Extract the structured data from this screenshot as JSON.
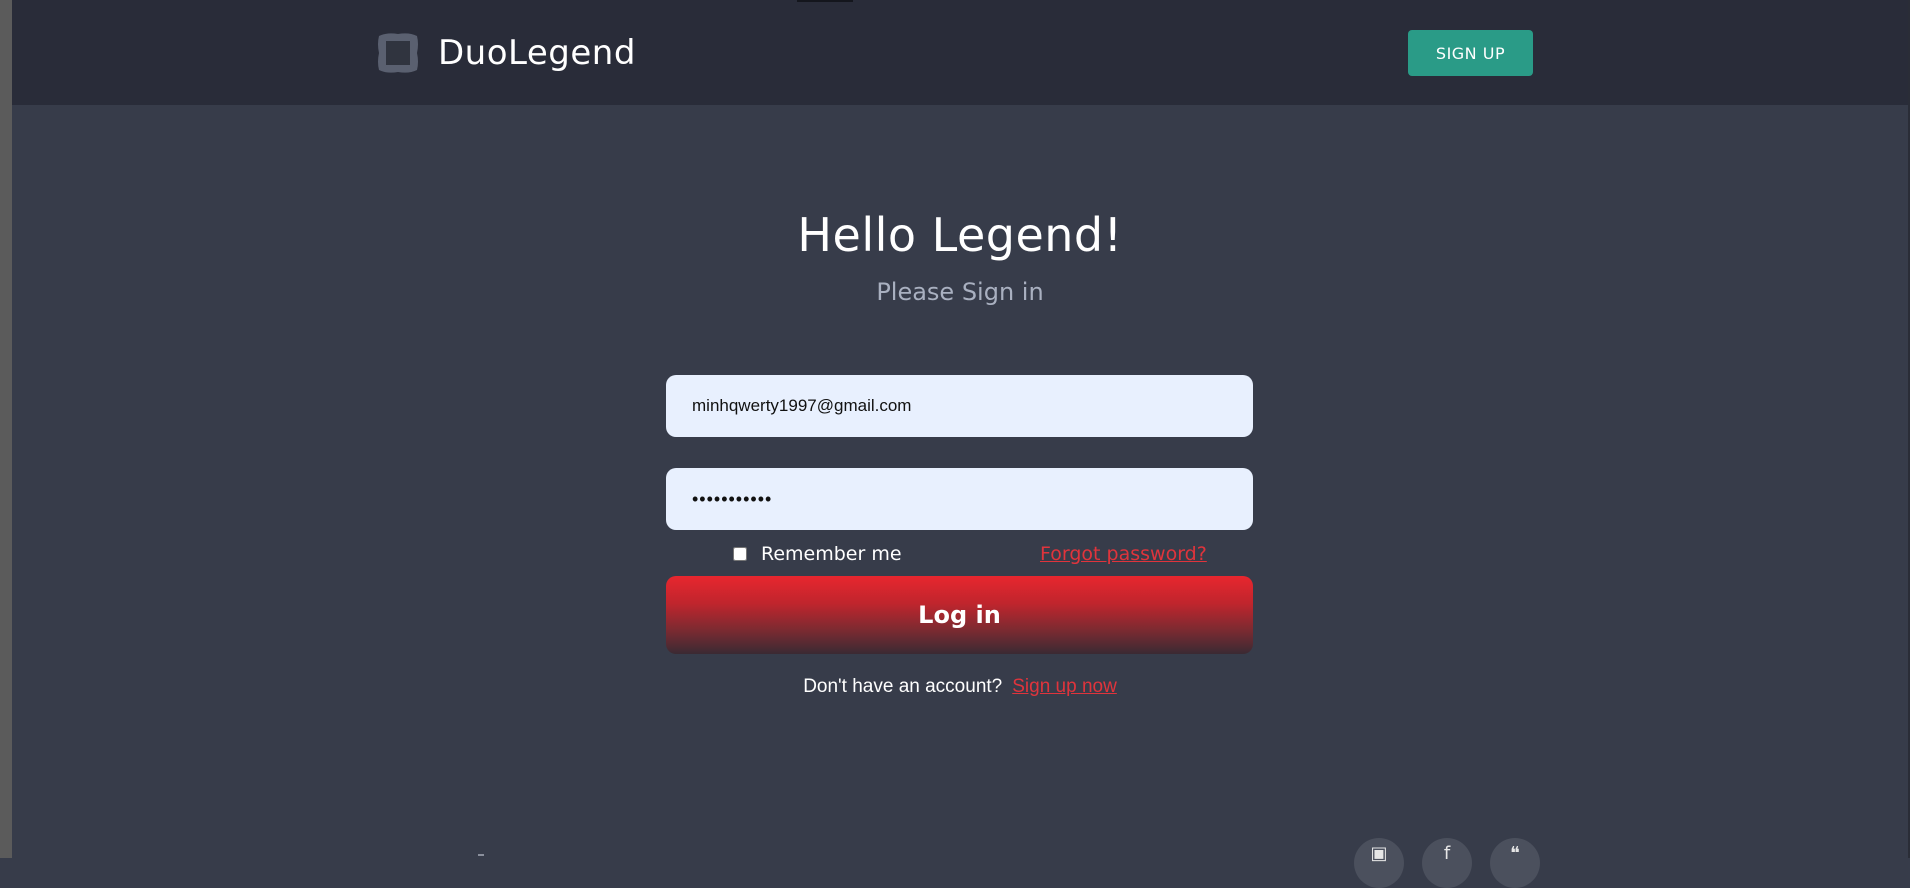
{
  "header": {
    "brand_name": "DuoLegend",
    "signup_label": "SIGN UP"
  },
  "login": {
    "title": "Hello Legend!",
    "subtitle": "Please Sign in",
    "email_value": "minhqwerty1997@gmail.com",
    "password_value": "•••••••••••",
    "remember_label": "Remember me",
    "forgot_label": "Forgot password?",
    "login_label": "Log in",
    "no_account_text": "Don't have an account?",
    "signup_now_label": "Sign up now"
  },
  "footer": {
    "social_icons": [
      "instagram-icon",
      "facebook-icon",
      "twitter-icon"
    ]
  },
  "colors": {
    "background": "#373c4a",
    "topbar": "#292c39",
    "accent_teal": "#2a9b87",
    "accent_red": "#e0343c",
    "input_bg": "#e8f0fe"
  }
}
